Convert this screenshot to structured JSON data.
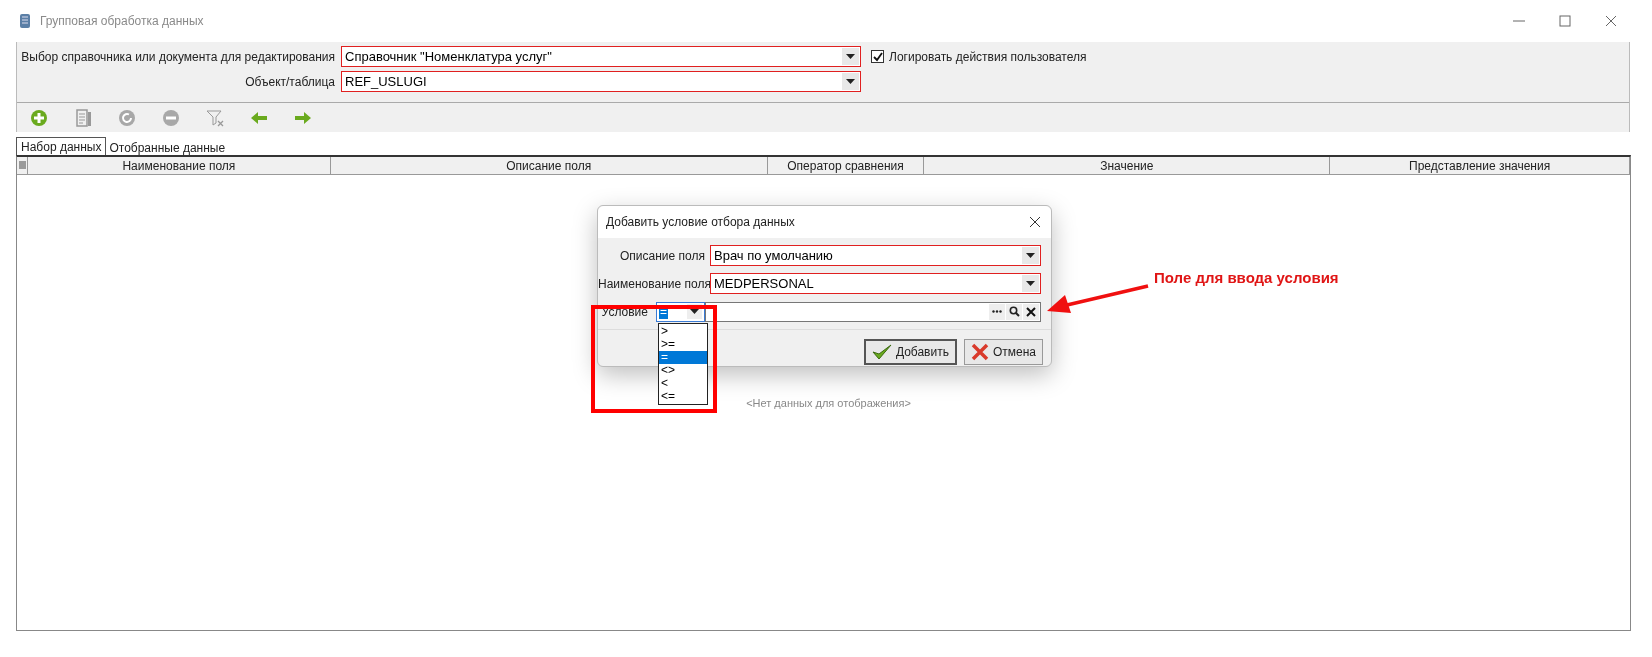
{
  "window": {
    "title": "Групповая обработка данных"
  },
  "form": {
    "fields": [
      {
        "label": "Выбор справочника или документа для редактирования",
        "value": "Справочник \"Номенклатура услуг\""
      },
      {
        "label": "Объект/таблица",
        "value": "REF_USLUGI"
      }
    ],
    "log_checkbox": {
      "label": "Логировать действия пользователя",
      "checked": true
    }
  },
  "toolbar": {
    "buttons": [
      {
        "kind": "add",
        "disabled": false
      },
      {
        "kind": "edit",
        "disabled": true
      },
      {
        "kind": "refresh",
        "disabled": true
      },
      {
        "kind": "remove",
        "disabled": true
      },
      {
        "kind": "clear_filter",
        "disabled": true
      },
      {
        "kind": "back",
        "disabled": false
      },
      {
        "kind": "forward",
        "disabled": false
      }
    ]
  },
  "tabs": [
    {
      "label": "Набор данных",
      "selected": true
    },
    {
      "label": "Отобранные данные",
      "selected": false
    }
  ],
  "table": {
    "columns": [
      "Наименование поля",
      "Описание поля",
      "Оператор сравнения",
      "Значение",
      "Представление значения"
    ],
    "empty_message": "<Нет данных для отображения>"
  },
  "dialog": {
    "title": "Добавить условие отбора данных",
    "fields": [
      {
        "label": "Описание поля",
        "value": "Врач по умолчанию"
      },
      {
        "label": "Наименование поля",
        "value": "MEDPERSONAL"
      }
    ],
    "condition": {
      "label": "Условие",
      "operator": "=",
      "options": [
        {
          "label": ">",
          "selected": false
        },
        {
          "label": ">=",
          "selected": false
        },
        {
          "label": "=",
          "selected": true
        },
        {
          "label": "<>",
          "selected": false
        },
        {
          "label": "<",
          "selected": false
        },
        {
          "label": "<=",
          "selected": false
        }
      ]
    },
    "buttons": [
      {
        "kind": "ok",
        "label": "Добавить"
      },
      {
        "kind": "cancel",
        "label": "Отмена"
      }
    ]
  },
  "annotation": {
    "text": "Поле для ввода условия"
  }
}
